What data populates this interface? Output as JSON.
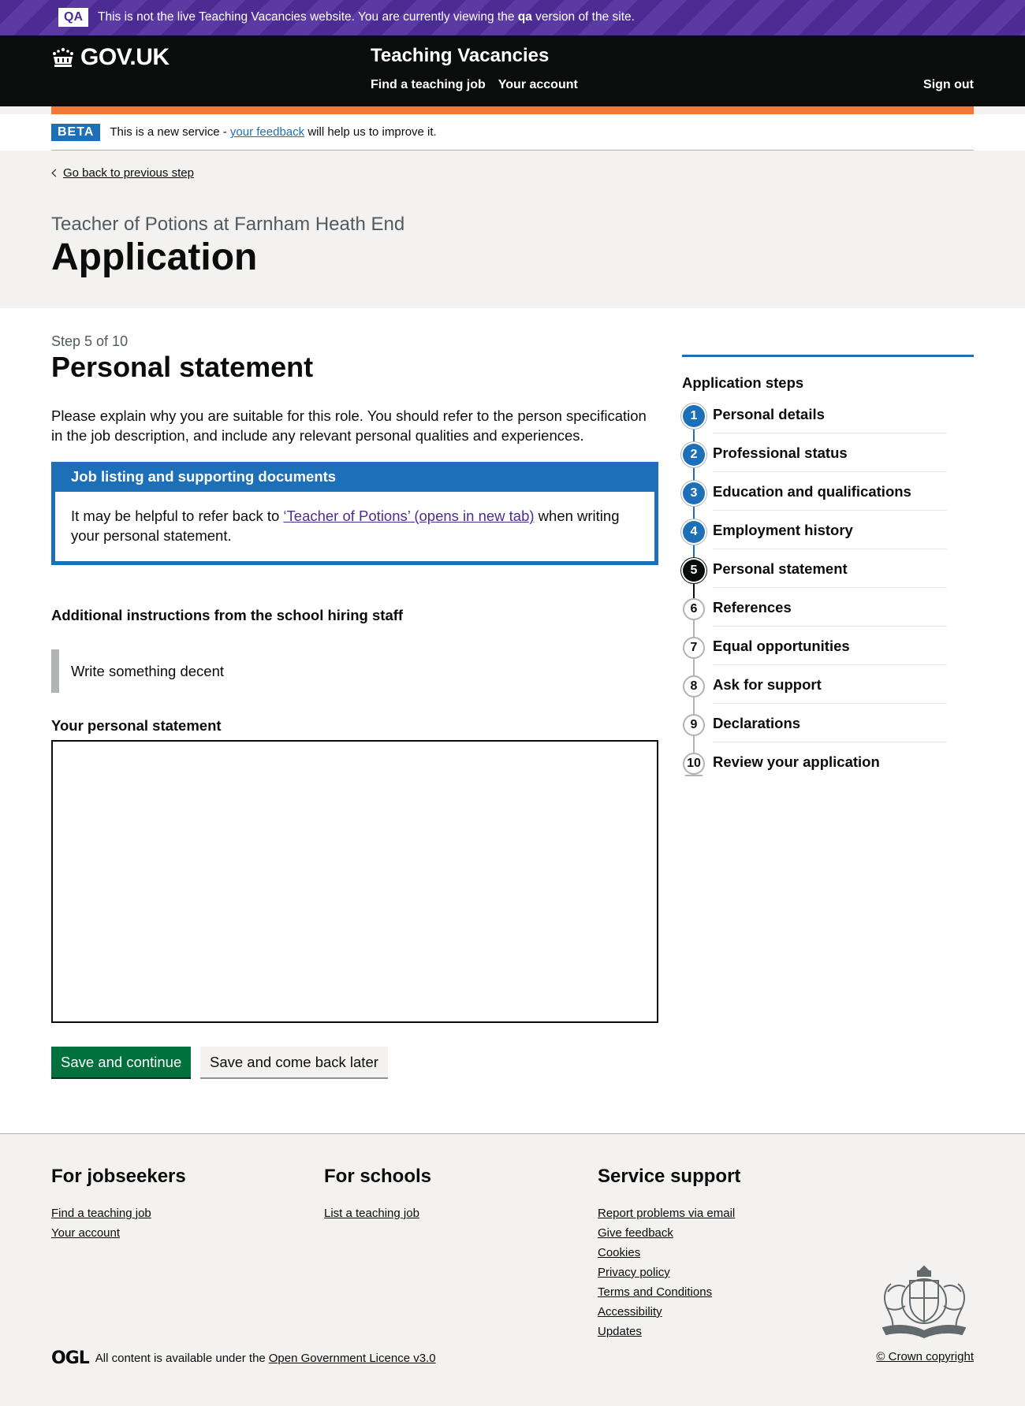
{
  "qa_banner": {
    "tag": "QA",
    "message_before": "This is not the live Teaching Vacancies website. You are currently viewing the ",
    "message_bold": "qa",
    "message_after": " version of the site."
  },
  "header": {
    "logo": "GOV.UK",
    "service_name": "Teaching Vacancies",
    "nav": [
      "Find a teaching job",
      "Your account"
    ],
    "sign_out": "Sign out"
  },
  "phase_banner": {
    "tag": "BETA",
    "text_before": "This is a new service - ",
    "link": "your feedback",
    "text_after": " will help us to improve it."
  },
  "back_link": "Go back to previous step",
  "caption": "Teacher of Potions at Farnham Heath End",
  "title": "Application",
  "form": {
    "step": "Step 5 of 10",
    "heading": "Personal statement",
    "intro": "Please explain why you are suitable for this role. You should refer to the person specification in the job description, and include any relevant personal qualities and experiences.",
    "docs_box": {
      "heading": "Job listing and supporting documents",
      "text_before": "It may be helpful to refer back to ",
      "link": "‘Teacher of Potions’ (opens in new tab)",
      "text_after": " when writing your personal statement."
    },
    "instructions_heading": "Additional instructions from the school hiring staff",
    "instructions_text": "Write something decent",
    "statement_label": "Your personal statement",
    "statement_value": "",
    "primary_button": "Save and continue",
    "secondary_button": "Save and come back later"
  },
  "steps": {
    "title": "Application steps",
    "items": [
      {
        "number": "1",
        "label": "Personal details",
        "state": "done"
      },
      {
        "number": "2",
        "label": "Professional status",
        "state": "done"
      },
      {
        "number": "3",
        "label": "Education and qualifications",
        "state": "done"
      },
      {
        "number": "4",
        "label": "Employment history",
        "state": "done"
      },
      {
        "number": "5",
        "label": "Personal statement",
        "state": "current"
      },
      {
        "number": "6",
        "label": "References",
        "state": "todo"
      },
      {
        "number": "7",
        "label": "Equal opportunities",
        "state": "todo"
      },
      {
        "number": "8",
        "label": "Ask for support",
        "state": "todo"
      },
      {
        "number": "9",
        "label": "Declarations",
        "state": "todo"
      },
      {
        "number": "10",
        "label": "Review your application",
        "state": "todo"
      }
    ],
    "colors": {
      "done": "#1d70b8",
      "current": "#0b0c0c",
      "todo": "#b1b4b6"
    }
  },
  "footer": {
    "columns": [
      {
        "heading": "For jobseekers",
        "links": [
          "Find a teaching job",
          "Your account"
        ]
      },
      {
        "heading": "For schools",
        "links": [
          "List a teaching job"
        ]
      },
      {
        "heading": "Service support",
        "links": [
          "Report problems via email",
          "Give feedback",
          "Cookies",
          "Privacy policy",
          "Terms and Conditions",
          "Accessibility",
          "Updates"
        ]
      }
    ],
    "ogl_mark": "OGL",
    "licence_text": "All content is available under the",
    "licence_link": "Open Government Licence v3.0",
    "copyright": "© Crown copyright"
  }
}
